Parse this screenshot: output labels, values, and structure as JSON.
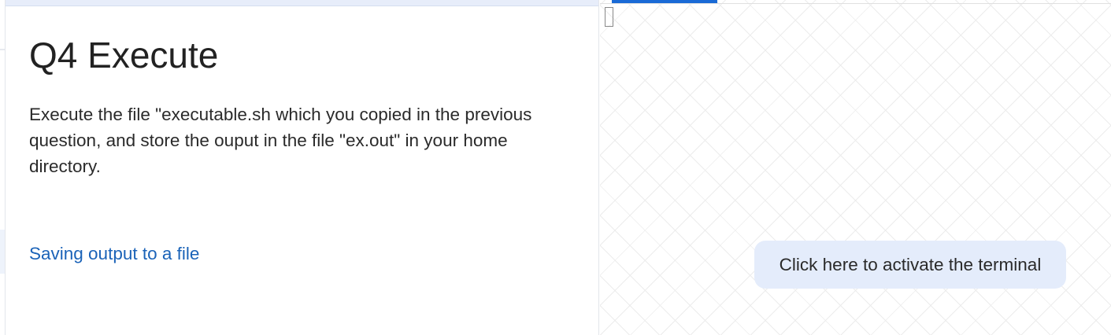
{
  "question": {
    "title": "Q4 Execute",
    "body": "Execute the file \"executable.sh which you copied in the previous question, and store the ouput in the file \"ex.out\" in your home directory.",
    "resource_link": "Saving output to a file"
  },
  "terminal": {
    "activate_label": "Click here to activate the terminal"
  },
  "colors": {
    "accent": "#1a6ad6",
    "link": "#1b63b8",
    "button_bg": "#e4ecfb"
  }
}
